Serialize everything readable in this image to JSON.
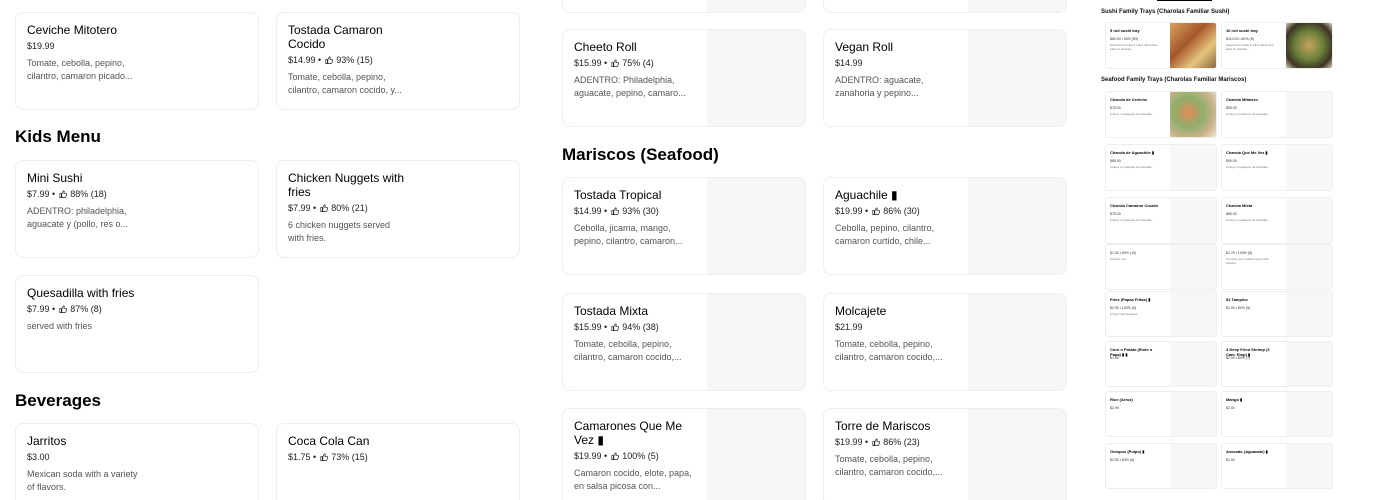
{
  "col1": {
    "cards": [
      {
        "title": "Ceviche Mitotero",
        "price": "$19.99",
        "rating": "",
        "desc": "Tomate, cebolla, pepino, cilantro, camaron picado..."
      },
      {
        "title": "Tostada Camaron Cocido",
        "price": "$14.99",
        "rating": "93% (15)",
        "desc": "Tomate, cebolla, pepino, cilantro, camaron cocido, y..."
      }
    ]
  },
  "kids": {
    "heading": "Kids Menu",
    "cards": [
      {
        "title": "Mini Sushi",
        "price": "$7.99",
        "rating": "88% (18)",
        "desc": "ADENTRO: philadelphia, aguacate y (pollo, res o..."
      },
      {
        "title": "Chicken Nuggets with fries",
        "price": "$7.99",
        "rating": "80% (21)",
        "desc": "6 chicken nuggets served with fries."
      },
      {
        "title": "Quesadilla with fries",
        "price": "$7.99",
        "rating": "87% (8)",
        "desc": "served with fries"
      }
    ]
  },
  "beverages": {
    "heading": "Beverages",
    "cards": [
      {
        "title": "Jarritos",
        "price": "$3.00",
        "rating": "",
        "desc": "Mexican soda with a variety of flavors."
      },
      {
        "title": "Coca Cola Can",
        "price": "$1.75",
        "rating": "73% (15)",
        "desc": ""
      }
    ]
  },
  "col2top": {
    "cards": [
      {
        "title": "Cheeto Roll",
        "price": "$15.99",
        "rating": "75% (4)",
        "desc": "ADENTRO: Philadelphia, aguacate, pepino, camaro..."
      },
      {
        "title": "Vegan Roll",
        "price": "$14.99",
        "rating": "",
        "desc": "ADENTRO: aguacate, zanahoria y pepino..."
      }
    ]
  },
  "mariscos": {
    "heading": "Mariscos (Seafood)",
    "cards": [
      {
        "title": "Tostada Tropical",
        "price": "$14.99",
        "rating": "93% (30)",
        "desc": "Cebolla, jicama, mango, pepino, cilantro, camaron..."
      },
      {
        "title": "Aguachile ▮",
        "price": "$19.99",
        "rating": "86% (30)",
        "desc": "Cebolla, pepino, cilantro, camaron curtido, chile..."
      },
      {
        "title": "Tostada Mixta",
        "price": "$15.99",
        "rating": "94% (38)",
        "desc": "Tomate, cebolla, pepino, cilantro, camaron cocido,..."
      },
      {
        "title": "Molcajete",
        "price": "$21.99",
        "rating": "",
        "desc": "Tomate, cebolla, pepino, cilantro, camaron cocido,..."
      },
      {
        "title": "Camarones Que Me Vez ▮",
        "price": "$19.99",
        "rating": "100% (5)",
        "desc": "Camaron cocido, elote, papa, en salsa picosa con..."
      },
      {
        "title": "Torre de Mariscos",
        "price": "$19.99",
        "rating": "86% (23)",
        "desc": "Tomate, cebolla, pepino, cilantro, camaron cocido,..."
      }
    ]
  },
  "mini": {
    "heading1": "Sushi Family Trays (Charolas Familiar Sushi)",
    "heading2": "Seafood Family Trays (Charolas Familiar Mariscos)",
    "cards": [
      {
        "title": "5 roll sushi tray",
        "price": "$60.00 • 83% (53)",
        "desc": "Seleccione hasta 5 rollos diferentes para su charola..."
      },
      {
        "title": "10 roll sushi tray",
        "price": "$110.00 • 80% (8)",
        "desc": "Seleccione hasta 5 rollos diferentes para su charola..."
      },
      {
        "title": "Charola de Ceviche",
        "price": "$75.00",
        "desc": "incluye un paquete de tostadas..."
      },
      {
        "title": "Charola Mitotero",
        "price": "$95.00",
        "desc": "incluye un paquete de tostadas..."
      },
      {
        "title": "Charola de Aguachile ▮",
        "price": "$85.00",
        "desc": "incluye un paquete de tostadas..."
      },
      {
        "title": "Charola Que Me Vez ▮",
        "price": "$90.00",
        "desc": "incluye un paquete de tostadas..."
      },
      {
        "title": "Charola Camaron Cocido",
        "price": "$75.00",
        "desc": "incluye un paquete de tostadas..."
      },
      {
        "title": "Charola Mixta",
        "price": "$85.00",
        "desc": "incluye un paquete de tostadas..."
      },
      {
        "title": "",
        "price": "$1.00 • 80% (10)",
        "desc": "Choose one"
      },
      {
        "title": "",
        "price": "$1.75 • 100% (8)",
        "desc": "Crunchy corn tortilla topped with various..."
      },
      {
        "title": "Fries (Papas Fritas) ▮",
        "price": "$2.99 • 100% (5)",
        "desc": "Crispy fried potatoes"
      },
      {
        "title": "$1 Tampico",
        "price": "$1.99 • 80% (5)",
        "desc": ""
      },
      {
        "title": "Corn n Potato (Elote o Papa) ▮ ▮",
        "price": "$1.00",
        "desc": ""
      },
      {
        "title": "3 Deep Fried Shrimp (3 Cam. Emp) ▮",
        "price": "$2.99 • 80% (7)",
        "desc": ""
      },
      {
        "title": "Rice (Arroz)",
        "price": "$2.99",
        "desc": ""
      },
      {
        "title": "Mango ▮",
        "price": "$2.00",
        "desc": ""
      },
      {
        "title": "Octopus (Pulpo) ▮",
        "price": "$2.50 • 83% (6)",
        "desc": ""
      },
      {
        "title": "Avocado (Aguacate) ▮",
        "price": "$1.99",
        "desc": ""
      }
    ]
  }
}
